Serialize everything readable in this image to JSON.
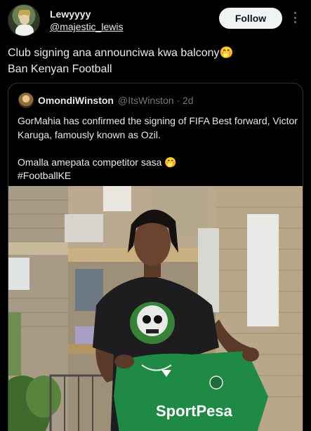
{
  "author": {
    "display_name": "Lewyyyy",
    "handle": "@majestic_lewis",
    "avatar_icon": "profile-avatar"
  },
  "follow_label": "Follow",
  "tweet": {
    "lines": [
      "Club signing ana announciwa kwa balcony🤭",
      "Ban Kenyan Football"
    ]
  },
  "quoted": {
    "name": "OmondiWinston",
    "handle": "@ItsWinston · 2d",
    "text": "GorMahia has confirmed the signing of FIFA Best forward, Victor Karuga, famously known as Ozil.\n\nOmalla amepata competitor sasa 🤭\n#FootballKE",
    "photo": {
      "jersey_brand": "SportPesa"
    }
  },
  "colors": {
    "background": "#000000",
    "text": "#e7e9ea",
    "muted": "#71767b",
    "border": "#2f3336",
    "follow_bg": "#eff3f4",
    "jersey_green": "#1f8a45"
  }
}
